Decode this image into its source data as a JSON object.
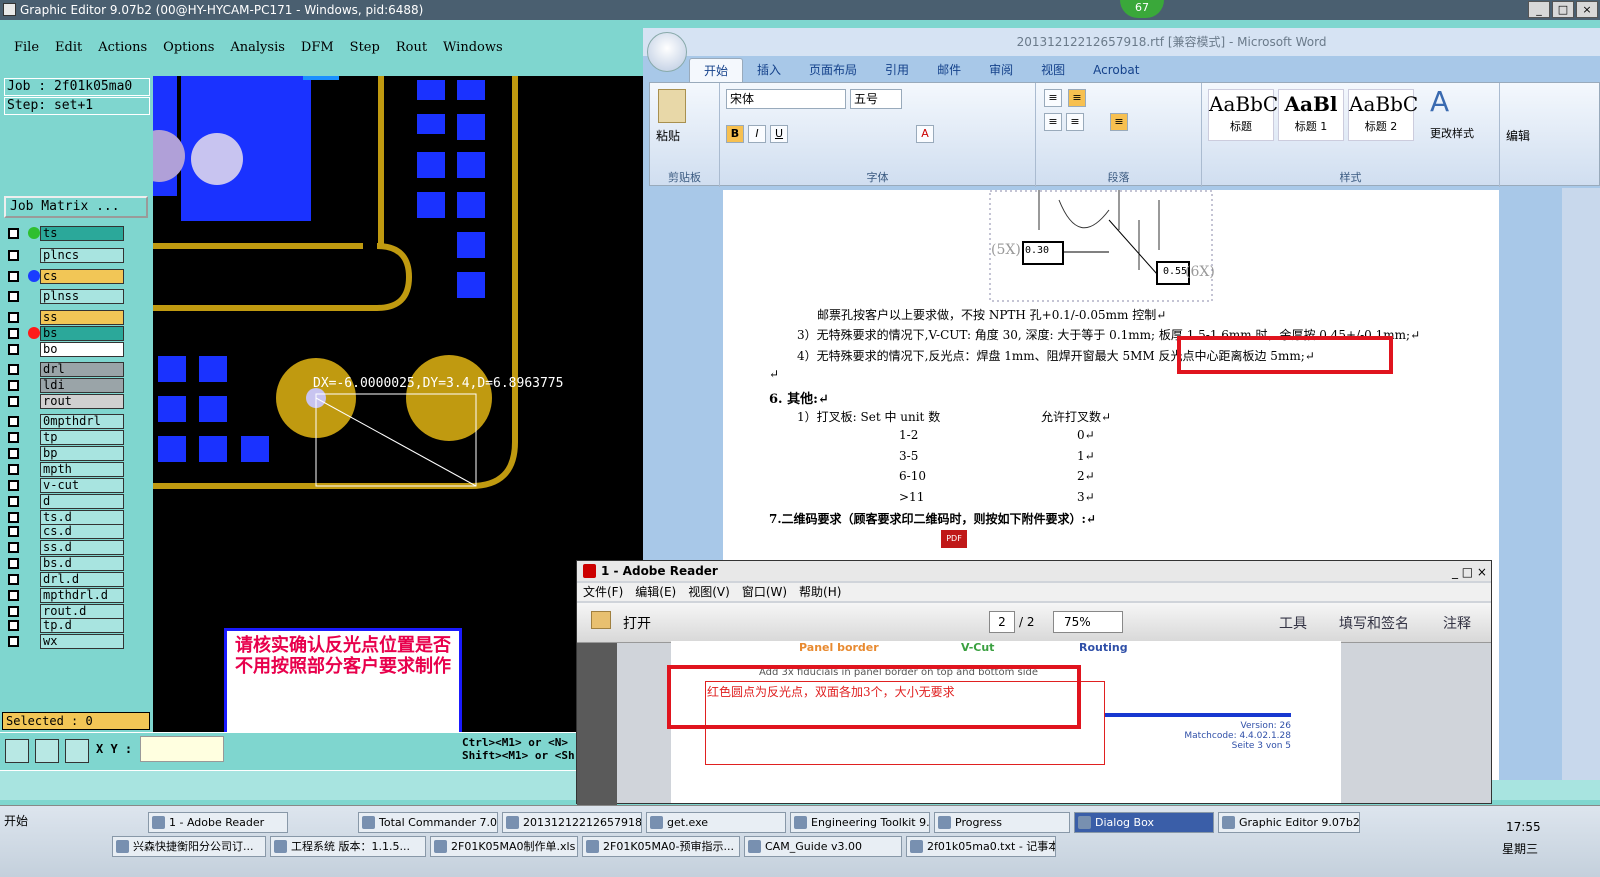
{
  "graphic_editor": {
    "title": "Graphic Editor 9.07b2 (00@HY-HYCAM-PC171 - Windows, pid:6488)",
    "menu": [
      "File",
      "Edit",
      "Actions",
      "Options",
      "Analysis",
      "DFM",
      "Step",
      "Rout",
      "Windows"
    ],
    "job": "Job : 2f01k05ma0",
    "step": "Step: set+1",
    "job_matrix": "Job Matrix ...",
    "layers": [
      "ts",
      "plncs",
      "cs",
      "plnss",
      "ss",
      "bs",
      "bo",
      "drl",
      "ldi",
      "rout",
      "0mpthdrl",
      "tp",
      "bp",
      "mpth",
      "v-cut",
      "d",
      "ts.d",
      "cs.d",
      "ss.d",
      "bs.d",
      "drl.d",
      "mpthdrl.d",
      "rout.d",
      "tp.d",
      "wx"
    ],
    "selected": "Selected : 0",
    "xy_label": "X Y :",
    "hint1": "Ctrl><M1> or <N>",
    "hint2": "Shift><M1> or <Sh",
    "measure": "DX=-6.0000025,DY=3.4,D=6.8963775",
    "note": "请核实确认反光点位置是否不用按照部分客户要求制作",
    "badge": "67"
  },
  "word": {
    "title": "20131212212657918.rtf [兼容模式] - Microsoft Word",
    "tabs": [
      "开始",
      "插入",
      "页面布局",
      "引用",
      "邮件",
      "审阅",
      "视图",
      "Acrobat"
    ],
    "font_name": "宋体",
    "font_size": "五号",
    "groups": [
      "剪贴板",
      "字体",
      "段落",
      "样式"
    ],
    "paste": "粘贴",
    "styles": [
      {
        "preview": "AaBbC",
        "name": "标题"
      },
      {
        "preview": "AaBl",
        "name": "标题 1"
      },
      {
        "preview": "AaBbC",
        "name": "标题 2"
      }
    ],
    "change_styles": "更改样式",
    "edit": "编辑",
    "drawing": {
      "label1": "0.30",
      "label2": "0.55",
      "label3": "(5X)",
      "label4": "(6X)"
    },
    "lines": [
      "邮票孔按客户以上要求做，不按 NPTH 孔+0.1/-0.05mm 控制↵",
      "3）无特殊要求的情况下,V-CUT: 角度 30, 深度: 大于等于 0.1mm; 板厚 1.5-1.6mm 时，余厚按 0.45+/-0.1mm;↵",
      "4）无特殊要求的情况下,反光点：焊盘 1mm、阻焊开窗最大 5MM 反光点中心距离板边 5mm;↵",
      "↵",
      "6.  其他:↵",
      "1）打叉板: Set 中 unit 数",
      "允许打叉数↵",
      "7.二维码要求（顾客要求印二维码时，则按如下附件要求）:↵"
    ],
    "table": [
      [
        "1-2",
        "0↵"
      ],
      [
        "3-5",
        "1↵"
      ],
      [
        "6-10",
        "2↵"
      ],
      [
        ">11",
        "3↵"
      ]
    ]
  },
  "reader": {
    "title": "1 - Adobe Reader",
    "menu": [
      "文件(F)",
      "编辑(E)",
      "视图(V)",
      "窗口(W)",
      "帮助(H)"
    ],
    "open": "打开",
    "page": "2",
    "pages": "/ 2",
    "zoom": "75%",
    "tools": [
      "工具",
      "填写和签名",
      "注释"
    ],
    "headers": [
      "Panel border",
      "V-Cut",
      "Routing"
    ],
    "fiducial_text": "Add 3x fiducials in panel border on top and bottom side",
    "annotation": "红色圆点为反光点，双面各加3个，大小无要求",
    "version": "Version: 26",
    "matchcode": "Matchcode: 4.4.02.1.28",
    "seite": "Seite 3 von 5"
  },
  "taskbar": {
    "start": "开始",
    "row1": [
      "1 - Adobe Reader",
      "Total Commander 7.0...",
      "20131212212657918...",
      "get.exe",
      "Engineering Toolkit 9....",
      "Progress",
      "Dialog Box",
      "Graphic Editor 9.07b2..."
    ],
    "row2": [
      "兴森快捷衡阳分公司订...",
      "工程系统  版本：1.1.5...",
      "2F01K05MA0制作单.xls ...",
      "2F01K05MA0-预审指示...",
      "CAM_Guide v3.00",
      "2f01k05ma0.txt - 记事本"
    ],
    "time": "17:55",
    "day": "星期三"
  }
}
